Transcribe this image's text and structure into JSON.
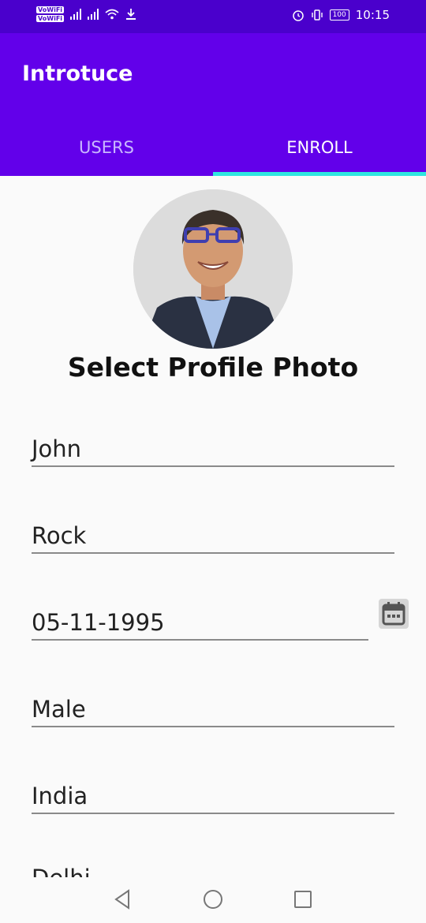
{
  "status_bar": {
    "volte_labels": [
      "VoWiFi",
      "VoWiFi"
    ],
    "battery": "100",
    "time": "10:15"
  },
  "app_bar": {
    "title": "Introtuce",
    "tabs": [
      {
        "label": "USERS",
        "selected": false
      },
      {
        "label": "ENROLL",
        "selected": true
      }
    ]
  },
  "profile": {
    "select_photo_label": "Select Profile Photo"
  },
  "form": {
    "first_name": "John",
    "last_name": "Rock",
    "dob": "05-11-1995",
    "gender": "Male",
    "country": "India",
    "state_partial": "Delhi"
  },
  "colors": {
    "status_bar": "#4a00cc",
    "app_bar": "#6200ea",
    "tab_indicator": "#2ee6e0",
    "background": "#fafafa"
  },
  "icons": {
    "calendar": "calendar-icon",
    "back": "triangle-back-icon",
    "home": "circle-home-icon",
    "recents": "square-recents-icon"
  }
}
